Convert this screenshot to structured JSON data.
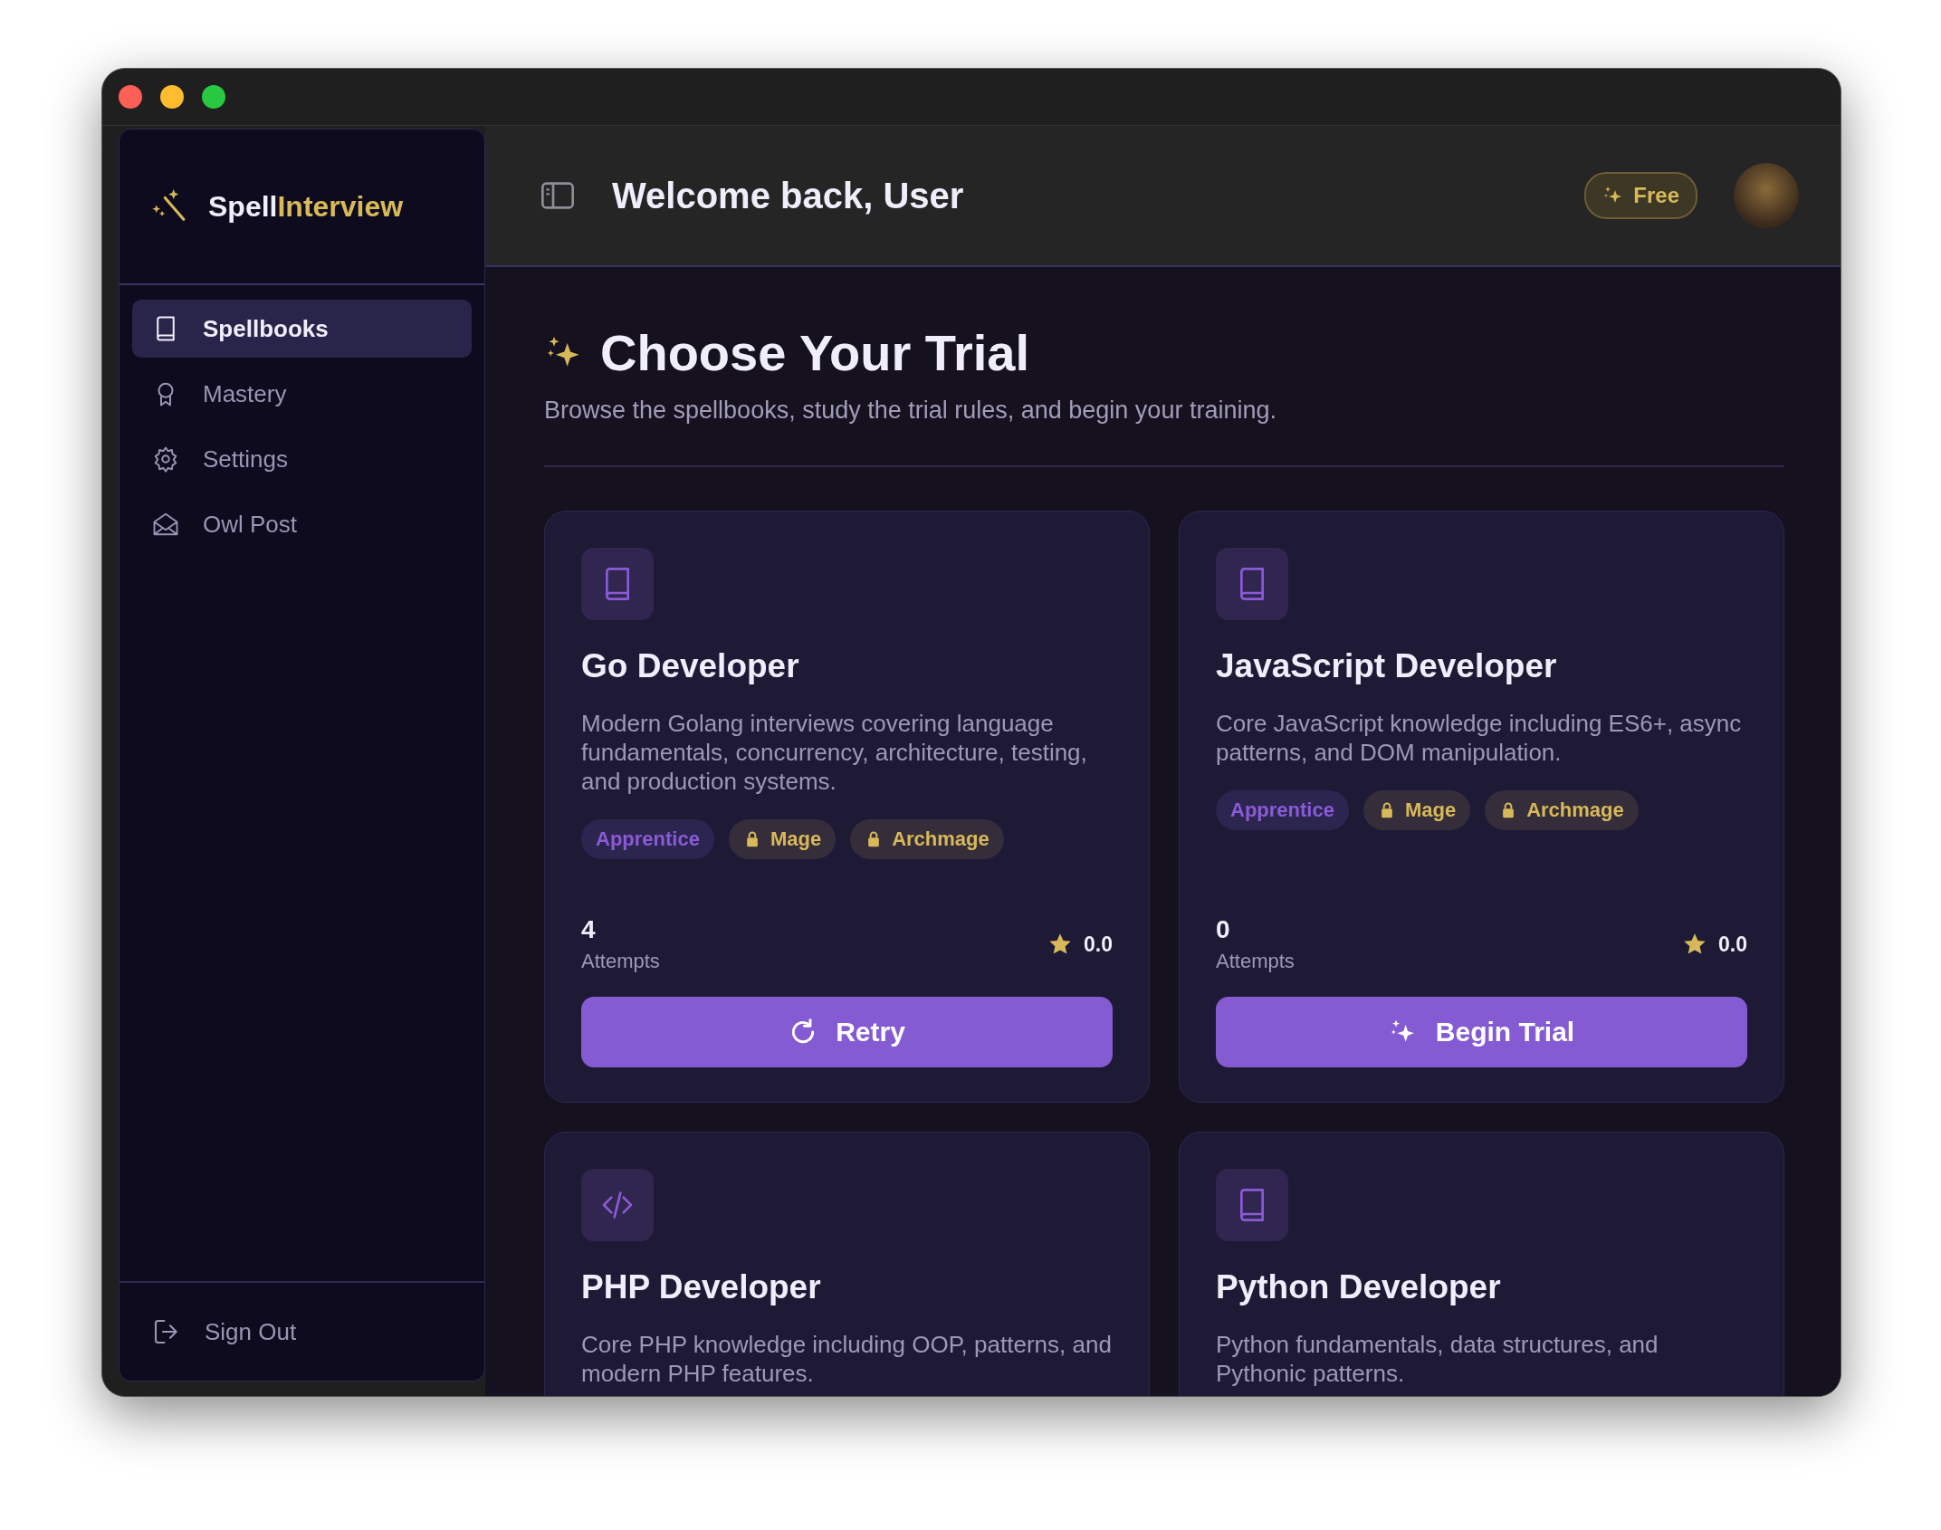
{
  "sidebar": {
    "brand": {
      "first": "Spell",
      "second": "Interview"
    },
    "items": [
      {
        "label": "Spellbooks",
        "kind": "book",
        "selected": true
      },
      {
        "label": "Mastery",
        "kind": "award",
        "selected": false
      },
      {
        "label": "Settings",
        "kind": "gear",
        "selected": false
      },
      {
        "label": "Owl Post",
        "kind": "mail",
        "selected": false
      }
    ],
    "footer": {
      "label": "Sign Out"
    }
  },
  "header": {
    "title": "Welcome back, User",
    "plan": "Free"
  },
  "page": {
    "title": "Choose Your Trial",
    "subtitle": "Browse the spellbooks, study the trial rules, and begin your training."
  },
  "cards": [
    {
      "kind": "book",
      "title": "Go Developer",
      "description": "Modern Golang interviews covering language fundamentals, concurrency, architecture, testing, and production systems.",
      "levels": [
        {
          "label": "Apprentice",
          "locked": false
        },
        {
          "label": "Mage",
          "locked": true
        },
        {
          "label": "Archmage",
          "locked": true
        }
      ],
      "attempts": "4",
      "attempts_label": "Attempts",
      "rating": "0.0",
      "button": {
        "kind": "retry",
        "label": "Retry"
      }
    },
    {
      "kind": "book",
      "title": "JavaScript Developer",
      "description": "Core JavaScript knowledge including ES6+, async patterns, and DOM manipulation.",
      "levels": [
        {
          "label": "Apprentice",
          "locked": false
        },
        {
          "label": "Mage",
          "locked": true
        },
        {
          "label": "Archmage",
          "locked": true
        }
      ],
      "attempts": "0",
      "attempts_label": "Attempts",
      "rating": "0.0",
      "button": {
        "kind": "begin",
        "label": "Begin Trial"
      }
    },
    {
      "kind": "code",
      "title": "PHP Developer",
      "description": "Core PHP knowledge including OOP, patterns, and modern PHP features."
    },
    {
      "kind": "book",
      "title": "Python Developer",
      "description": "Python fundamentals, data structures, and Pythonic patterns."
    }
  ]
}
